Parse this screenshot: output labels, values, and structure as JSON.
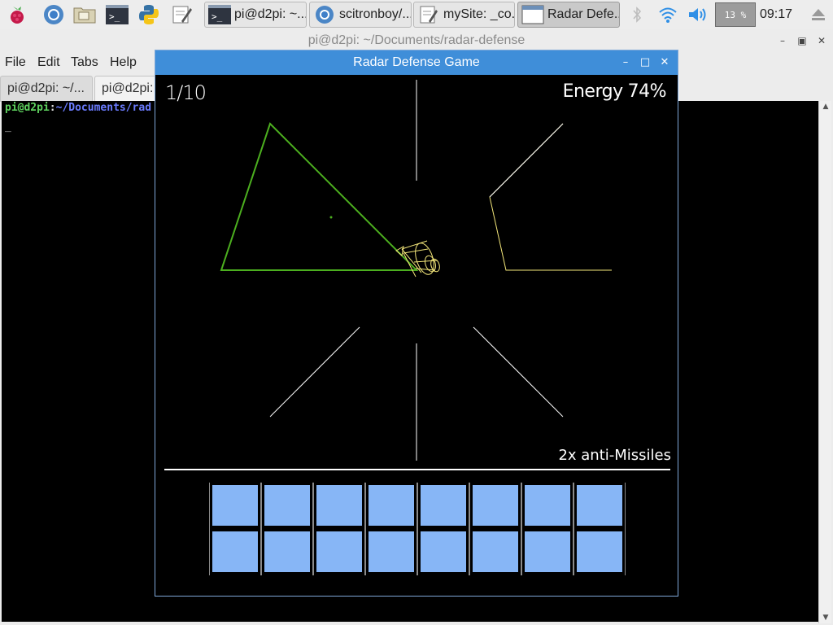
{
  "panel": {
    "launchers": [
      {
        "icon": "raspberry-menu-icon"
      },
      {
        "icon": "browser-icon"
      },
      {
        "icon": "file-manager-icon"
      },
      {
        "icon": "terminal-icon"
      },
      {
        "icon": "python-icon"
      },
      {
        "icon": "text-editor-icon"
      }
    ],
    "tasks": [
      {
        "label": "pi@d2pi: ~...",
        "icon": "terminal-icon",
        "active": false
      },
      {
        "label": "scitronboy/...",
        "icon": "browser-icon",
        "active": false
      },
      {
        "label": "mySite: _co...",
        "icon": "text-editor-icon",
        "active": false
      },
      {
        "label": "Radar Defe...",
        "icon": "window-icon",
        "active": true
      }
    ],
    "cpu": "13 %",
    "clock": "09:17"
  },
  "terminal": {
    "title": "pi@d2pi: ~/Documents/radar-defense",
    "menu": [
      "File",
      "Edit",
      "Tabs",
      "Help"
    ],
    "tabs": [
      "pi@d2pi: ~/...",
      "pi@d2pi:"
    ],
    "prompt_user": "pi@d2pi",
    "prompt_sep": ":",
    "prompt_path": "~/Documents/rad",
    "cursor": "_"
  },
  "game": {
    "title": "Radar Defense Game",
    "level": "1/10",
    "energy_label": "Energy",
    "energy_value": "74%",
    "missiles": "2x anti-Missiles",
    "grid_rows": 2,
    "grid_cols": 8,
    "colors": {
      "cell": "#87b6f6",
      "radar_active": "#4caf1f",
      "radar_passive": "#f4e77a",
      "lines": "#ffffff",
      "titlebar": "#3f8ed9"
    }
  }
}
